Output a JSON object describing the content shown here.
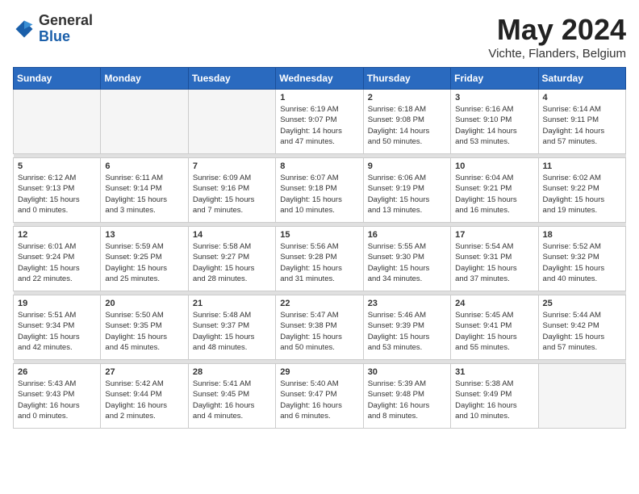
{
  "logo": {
    "general": "General",
    "blue": "Blue"
  },
  "title": "May 2024",
  "location": "Vichte, Flanders, Belgium",
  "days_of_week": [
    "Sunday",
    "Monday",
    "Tuesday",
    "Wednesday",
    "Thursday",
    "Friday",
    "Saturday"
  ],
  "weeks": [
    [
      {
        "day": "",
        "info": ""
      },
      {
        "day": "",
        "info": ""
      },
      {
        "day": "",
        "info": ""
      },
      {
        "day": "1",
        "info": "Sunrise: 6:19 AM\nSunset: 9:07 PM\nDaylight: 14 hours\nand 47 minutes."
      },
      {
        "day": "2",
        "info": "Sunrise: 6:18 AM\nSunset: 9:08 PM\nDaylight: 14 hours\nand 50 minutes."
      },
      {
        "day": "3",
        "info": "Sunrise: 6:16 AM\nSunset: 9:10 PM\nDaylight: 14 hours\nand 53 minutes."
      },
      {
        "day": "4",
        "info": "Sunrise: 6:14 AM\nSunset: 9:11 PM\nDaylight: 14 hours\nand 57 minutes."
      }
    ],
    [
      {
        "day": "5",
        "info": "Sunrise: 6:12 AM\nSunset: 9:13 PM\nDaylight: 15 hours\nand 0 minutes."
      },
      {
        "day": "6",
        "info": "Sunrise: 6:11 AM\nSunset: 9:14 PM\nDaylight: 15 hours\nand 3 minutes."
      },
      {
        "day": "7",
        "info": "Sunrise: 6:09 AM\nSunset: 9:16 PM\nDaylight: 15 hours\nand 7 minutes."
      },
      {
        "day": "8",
        "info": "Sunrise: 6:07 AM\nSunset: 9:18 PM\nDaylight: 15 hours\nand 10 minutes."
      },
      {
        "day": "9",
        "info": "Sunrise: 6:06 AM\nSunset: 9:19 PM\nDaylight: 15 hours\nand 13 minutes."
      },
      {
        "day": "10",
        "info": "Sunrise: 6:04 AM\nSunset: 9:21 PM\nDaylight: 15 hours\nand 16 minutes."
      },
      {
        "day": "11",
        "info": "Sunrise: 6:02 AM\nSunset: 9:22 PM\nDaylight: 15 hours\nand 19 minutes."
      }
    ],
    [
      {
        "day": "12",
        "info": "Sunrise: 6:01 AM\nSunset: 9:24 PM\nDaylight: 15 hours\nand 22 minutes."
      },
      {
        "day": "13",
        "info": "Sunrise: 5:59 AM\nSunset: 9:25 PM\nDaylight: 15 hours\nand 25 minutes."
      },
      {
        "day": "14",
        "info": "Sunrise: 5:58 AM\nSunset: 9:27 PM\nDaylight: 15 hours\nand 28 minutes."
      },
      {
        "day": "15",
        "info": "Sunrise: 5:56 AM\nSunset: 9:28 PM\nDaylight: 15 hours\nand 31 minutes."
      },
      {
        "day": "16",
        "info": "Sunrise: 5:55 AM\nSunset: 9:30 PM\nDaylight: 15 hours\nand 34 minutes."
      },
      {
        "day": "17",
        "info": "Sunrise: 5:54 AM\nSunset: 9:31 PM\nDaylight: 15 hours\nand 37 minutes."
      },
      {
        "day": "18",
        "info": "Sunrise: 5:52 AM\nSunset: 9:32 PM\nDaylight: 15 hours\nand 40 minutes."
      }
    ],
    [
      {
        "day": "19",
        "info": "Sunrise: 5:51 AM\nSunset: 9:34 PM\nDaylight: 15 hours\nand 42 minutes."
      },
      {
        "day": "20",
        "info": "Sunrise: 5:50 AM\nSunset: 9:35 PM\nDaylight: 15 hours\nand 45 minutes."
      },
      {
        "day": "21",
        "info": "Sunrise: 5:48 AM\nSunset: 9:37 PM\nDaylight: 15 hours\nand 48 minutes."
      },
      {
        "day": "22",
        "info": "Sunrise: 5:47 AM\nSunset: 9:38 PM\nDaylight: 15 hours\nand 50 minutes."
      },
      {
        "day": "23",
        "info": "Sunrise: 5:46 AM\nSunset: 9:39 PM\nDaylight: 15 hours\nand 53 minutes."
      },
      {
        "day": "24",
        "info": "Sunrise: 5:45 AM\nSunset: 9:41 PM\nDaylight: 15 hours\nand 55 minutes."
      },
      {
        "day": "25",
        "info": "Sunrise: 5:44 AM\nSunset: 9:42 PM\nDaylight: 15 hours\nand 57 minutes."
      }
    ],
    [
      {
        "day": "26",
        "info": "Sunrise: 5:43 AM\nSunset: 9:43 PM\nDaylight: 16 hours\nand 0 minutes."
      },
      {
        "day": "27",
        "info": "Sunrise: 5:42 AM\nSunset: 9:44 PM\nDaylight: 16 hours\nand 2 minutes."
      },
      {
        "day": "28",
        "info": "Sunrise: 5:41 AM\nSunset: 9:45 PM\nDaylight: 16 hours\nand 4 minutes."
      },
      {
        "day": "29",
        "info": "Sunrise: 5:40 AM\nSunset: 9:47 PM\nDaylight: 16 hours\nand 6 minutes."
      },
      {
        "day": "30",
        "info": "Sunrise: 5:39 AM\nSunset: 9:48 PM\nDaylight: 16 hours\nand 8 minutes."
      },
      {
        "day": "31",
        "info": "Sunrise: 5:38 AM\nSunset: 9:49 PM\nDaylight: 16 hours\nand 10 minutes."
      },
      {
        "day": "",
        "info": ""
      }
    ]
  ]
}
